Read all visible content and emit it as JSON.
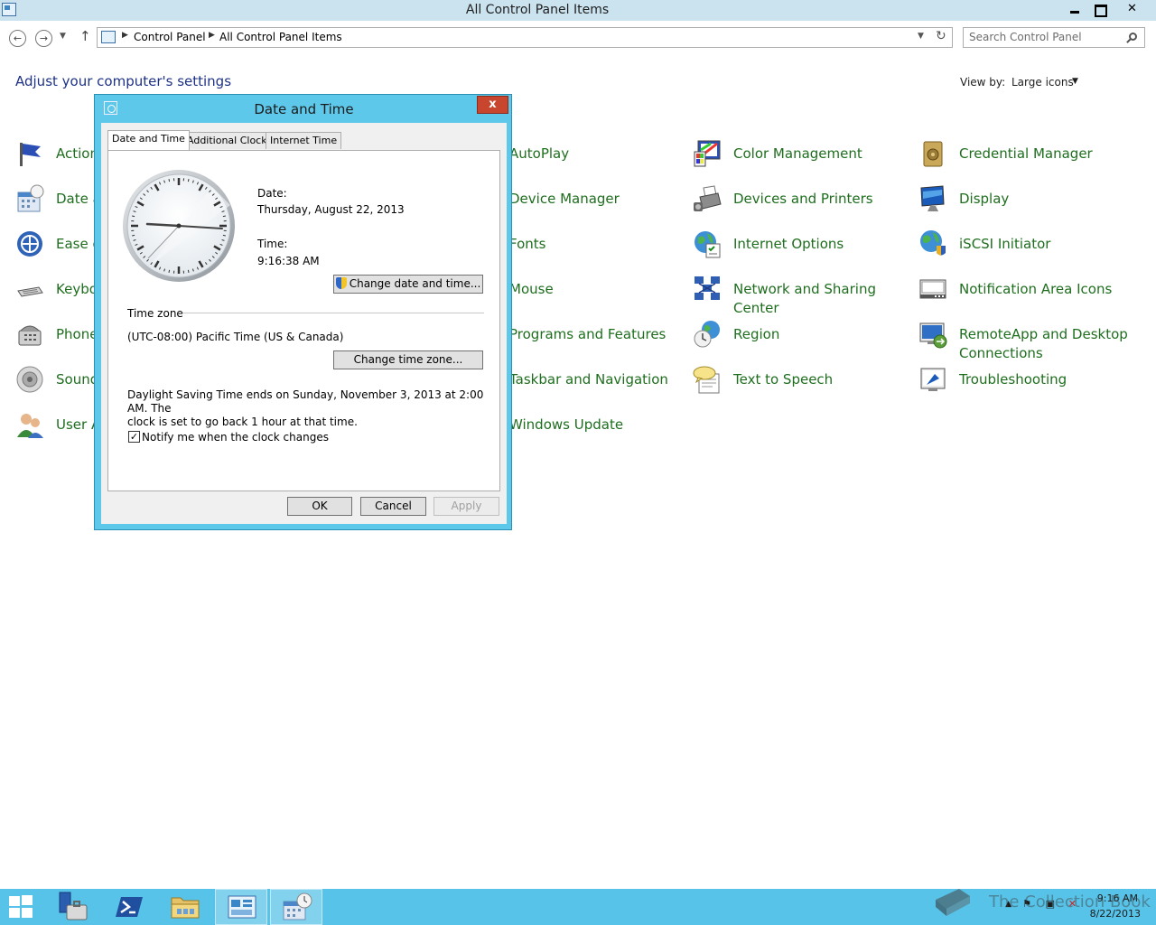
{
  "window": {
    "title": "All Control Panel Items",
    "min_label": "",
    "max_label": "",
    "close_label": "✕"
  },
  "nav": {
    "back": "←",
    "forward": "→",
    "recent": "▼",
    "up": "↑",
    "breadcrumb": [
      "Control Panel",
      "All Control Panel Items"
    ],
    "refresh": "↻",
    "dropdown": "▼",
    "search_placeholder": "Search Control Panel"
  },
  "content": {
    "heading": "Adjust your computer's settings",
    "view_by_label": "View by:",
    "view_by_value": "Large icons",
    "view_by_arrow": "▼"
  },
  "items": {
    "col1": [
      "Action",
      "Date a",
      "Ease o",
      "Keybo",
      "Phone",
      "Sound",
      "User A"
    ],
    "col2": [
      "AutoPlay",
      "Device Manager",
      "Fonts",
      "Mouse",
      "Programs and Features",
      "Taskbar and Navigation",
      "Windows Update"
    ],
    "col3": [
      "Color Management",
      "Devices and Printers",
      "Internet Options",
      "Network and Sharing",
      "Center",
      "Region",
      "Text to Speech"
    ],
    "col4": [
      "Credential Manager",
      "Display",
      "iSCSI Initiator",
      "Notification Area Icons",
      "RemoteApp and Desktop",
      "Connections",
      "Troubleshooting"
    ]
  },
  "icons": {
    "col1": [
      "flag-icon",
      "calendar-icon",
      "ease-of-access-icon",
      "keyboard-icon",
      "phone-icon",
      "speaker-icon",
      "users-icon"
    ],
    "col3": [
      "color-management-icon",
      "printer-icon",
      "globe-icon",
      "network-icon",
      "region-icon",
      "speech-bubble-icon"
    ],
    "col4": [
      "vault-icon",
      "monitor-icon",
      "iscsi-globe-icon",
      "notification-area-icon",
      "remoteapp-icon",
      "troubleshooting-icon"
    ]
  },
  "dialog": {
    "title": "Date and Time",
    "close": "x",
    "tabs": [
      "Date and Time",
      "Additional Clocks",
      "Internet Time"
    ],
    "date_label": "Date:",
    "date_value": "Thursday, August 22, 2013",
    "time_label": "Time:",
    "time_value": "9:16:38 AM",
    "change_datetime": "Change date and time...",
    "timezone_label": "Time zone",
    "timezone_value": "(UTC-08:00) Pacific Time (US & Canada)",
    "change_timezone": "Change time zone...",
    "dst_line1": "Daylight Saving Time ends on Sunday, November 3, 2013 at 2:00 AM. The",
    "dst_line2": "clock is set to go back 1 hour at that time.",
    "notify_label": "Notify me when the clock changes",
    "notify_checked": "✓",
    "ok": "OK",
    "cancel": "Cancel",
    "apply": "Apply"
  },
  "taskbar": {
    "clock_time": "9:16 AM",
    "clock_date": "8/22/2013",
    "watermark": "The Collection Book",
    "tray_arrow": "▲"
  }
}
